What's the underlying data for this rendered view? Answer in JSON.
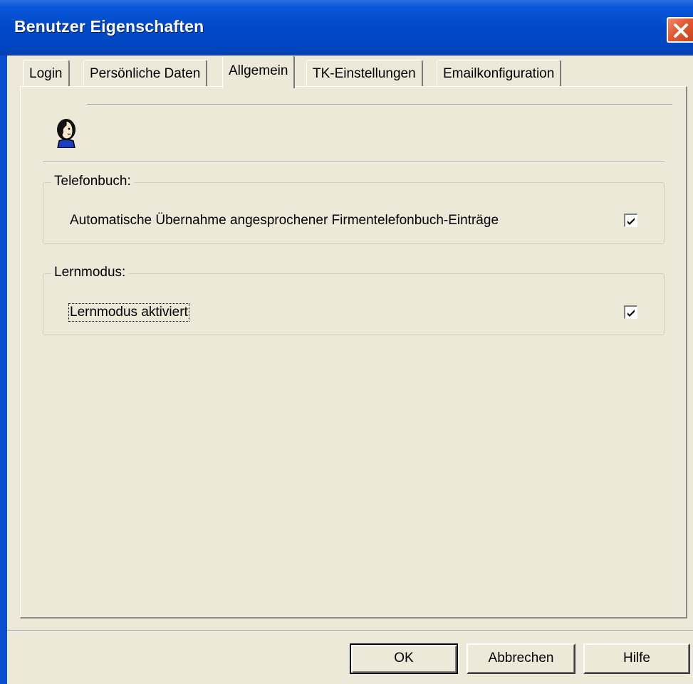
{
  "window": {
    "title": "Benutzer Eigenschaften"
  },
  "tabs": [
    {
      "label": "Login",
      "active": false
    },
    {
      "label": "Persönliche Daten",
      "active": false
    },
    {
      "label": "Allgemein",
      "active": true
    },
    {
      "label": "TK-Einstellungen",
      "active": false
    },
    {
      "label": "Emailkonfiguration",
      "active": false
    }
  ],
  "telefonbuch": {
    "legend": "Telefonbuch:",
    "option_label": "Automatische Übernahme angesprochener Firmentelefonbuch-Einträge",
    "checked": true
  },
  "lernmodus": {
    "legend": "Lernmodus:",
    "option_label": "Lernmodus aktiviert",
    "checked": true
  },
  "buttons": {
    "ok": "OK",
    "cancel": "Abbrechen",
    "help": "Hilfe"
  },
  "colors": {
    "titlebar": "#0049c8",
    "face": "#ece9d8",
    "close": "#e05a32"
  },
  "icons": {
    "title_close": "close-icon",
    "page": "user-profile-icon",
    "check": "check-icon"
  }
}
